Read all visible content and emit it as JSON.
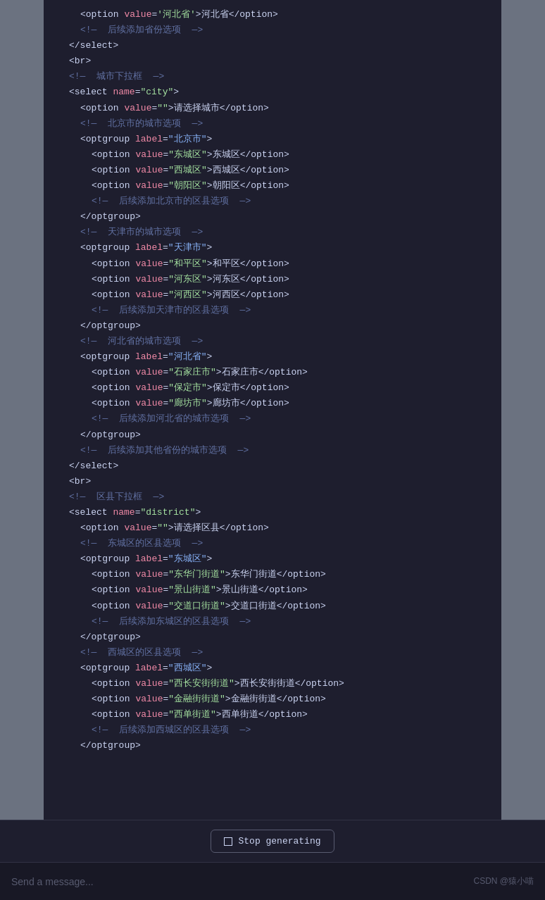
{
  "watermark": "CSDN @猿小喵",
  "input_placeholder": "Send a message...",
  "stop_button_label": "Stop generating",
  "code": {
    "lines": [
      {
        "indent": 2,
        "parts": [
          {
            "type": "tag",
            "text": "<option "
          },
          {
            "type": "attr-name",
            "text": "value"
          },
          {
            "type": "tag",
            "text": "="
          },
          {
            "type": "attr-value",
            "text": "'河北省'"
          },
          {
            "type": "tag",
            "text": ">河北省</option>"
          }
        ]
      },
      {
        "indent": 2,
        "parts": [
          {
            "type": "comment",
            "text": "<!—  后续添加省份选项  —>"
          }
        ]
      },
      {
        "indent": 1,
        "parts": [
          {
            "type": "tag",
            "text": "</select>"
          }
        ]
      },
      {
        "indent": 1,
        "parts": [
          {
            "type": "tag",
            "text": "<br>"
          }
        ]
      },
      {
        "indent": 1,
        "parts": [
          {
            "type": "comment",
            "text": "<!—  城市下拉框  —>"
          }
        ]
      },
      {
        "indent": 1,
        "parts": [
          {
            "type": "tag",
            "text": "<select "
          },
          {
            "type": "attr-name",
            "text": "name"
          },
          {
            "type": "tag",
            "text": "="
          },
          {
            "type": "attr-value",
            "text": "\"city\""
          },
          {
            "type": "tag",
            "text": ">"
          }
        ]
      },
      {
        "indent": 2,
        "parts": [
          {
            "type": "tag",
            "text": "<option "
          },
          {
            "type": "attr-name",
            "text": "value"
          },
          {
            "type": "tag",
            "text": "="
          },
          {
            "type": "attr-value",
            "text": "\"\""
          },
          {
            "type": "tag",
            "text": ">请选择城市</option>"
          }
        ]
      },
      {
        "indent": 2,
        "parts": [
          {
            "type": "comment",
            "text": "<!—  北京市的城市选项  —>"
          }
        ]
      },
      {
        "indent": 2,
        "parts": [
          {
            "type": "tag",
            "text": "<optgroup "
          },
          {
            "type": "attr-name",
            "text": "label"
          },
          {
            "type": "tag",
            "text": "="
          },
          {
            "type": "label-value",
            "text": "\"北京市\""
          },
          {
            "type": "tag",
            "text": ">"
          }
        ]
      },
      {
        "indent": 3,
        "parts": [
          {
            "type": "tag",
            "text": "<option "
          },
          {
            "type": "attr-name",
            "text": "value"
          },
          {
            "type": "tag",
            "text": "="
          },
          {
            "type": "attr-value",
            "text": "\"东城区\""
          },
          {
            "type": "tag",
            "text": ">东城区</option>"
          }
        ]
      },
      {
        "indent": 3,
        "parts": [
          {
            "type": "tag",
            "text": "<option "
          },
          {
            "type": "attr-name",
            "text": "value"
          },
          {
            "type": "tag",
            "text": "="
          },
          {
            "type": "attr-value",
            "text": "\"西城区\""
          },
          {
            "type": "tag",
            "text": ">西城区</option>"
          }
        ]
      },
      {
        "indent": 3,
        "parts": [
          {
            "type": "tag",
            "text": "<option "
          },
          {
            "type": "attr-name",
            "text": "value"
          },
          {
            "type": "tag",
            "text": "="
          },
          {
            "type": "attr-value",
            "text": "\"朝阳区\""
          },
          {
            "type": "tag",
            "text": ">朝阳区</option>"
          }
        ]
      },
      {
        "indent": 3,
        "parts": [
          {
            "type": "comment",
            "text": "<!—  后续添加北京市的区县选项  —>"
          }
        ]
      },
      {
        "indent": 2,
        "parts": [
          {
            "type": "tag",
            "text": "</optgroup>"
          }
        ]
      },
      {
        "indent": 2,
        "parts": [
          {
            "type": "comment",
            "text": "<!—  天津市的城市选项  —>"
          }
        ]
      },
      {
        "indent": 2,
        "parts": [
          {
            "type": "tag",
            "text": "<optgroup "
          },
          {
            "type": "attr-name",
            "text": "label"
          },
          {
            "type": "tag",
            "text": "="
          },
          {
            "type": "label-value",
            "text": "\"天津市\""
          },
          {
            "type": "tag",
            "text": ">"
          }
        ]
      },
      {
        "indent": 3,
        "parts": [
          {
            "type": "tag",
            "text": "<option "
          },
          {
            "type": "attr-name",
            "text": "value"
          },
          {
            "type": "tag",
            "text": "="
          },
          {
            "type": "attr-value",
            "text": "\"和平区\""
          },
          {
            "type": "tag",
            "text": ">和平区</option>"
          }
        ]
      },
      {
        "indent": 3,
        "parts": [
          {
            "type": "tag",
            "text": "<option "
          },
          {
            "type": "attr-name",
            "text": "value"
          },
          {
            "type": "tag",
            "text": "="
          },
          {
            "type": "attr-value",
            "text": "\"河东区\""
          },
          {
            "type": "tag",
            "text": ">河东区</option>"
          }
        ]
      },
      {
        "indent": 3,
        "parts": [
          {
            "type": "tag",
            "text": "<option "
          },
          {
            "type": "attr-name",
            "text": "value"
          },
          {
            "type": "tag",
            "text": "="
          },
          {
            "type": "attr-value",
            "text": "\"河西区\""
          },
          {
            "type": "tag",
            "text": ">河西区</option>"
          }
        ]
      },
      {
        "indent": 3,
        "parts": [
          {
            "type": "comment",
            "text": "<!—  后续添加天津市的区县选项  —>"
          }
        ]
      },
      {
        "indent": 2,
        "parts": [
          {
            "type": "tag",
            "text": "</optgroup>"
          }
        ]
      },
      {
        "indent": 2,
        "parts": [
          {
            "type": "comment",
            "text": "<!—  河北省的城市选项  —>"
          }
        ]
      },
      {
        "indent": 2,
        "parts": [
          {
            "type": "tag",
            "text": "<optgroup "
          },
          {
            "type": "attr-name",
            "text": "label"
          },
          {
            "type": "tag",
            "text": "="
          },
          {
            "type": "label-value",
            "text": "\"河北省\""
          },
          {
            "type": "tag",
            "text": ">"
          }
        ]
      },
      {
        "indent": 3,
        "parts": [
          {
            "type": "tag",
            "text": "<option "
          },
          {
            "type": "attr-name",
            "text": "value"
          },
          {
            "type": "tag",
            "text": "="
          },
          {
            "type": "attr-value",
            "text": "\"石家庄市\""
          },
          {
            "type": "tag",
            "text": ">石家庄市</option>"
          }
        ]
      },
      {
        "indent": 3,
        "parts": [
          {
            "type": "tag",
            "text": "<option "
          },
          {
            "type": "attr-name",
            "text": "value"
          },
          {
            "type": "tag",
            "text": "="
          },
          {
            "type": "attr-value",
            "text": "\"保定市\""
          },
          {
            "type": "tag",
            "text": ">保定市</option>"
          }
        ]
      },
      {
        "indent": 3,
        "parts": [
          {
            "type": "tag",
            "text": "<option "
          },
          {
            "type": "attr-name",
            "text": "value"
          },
          {
            "type": "tag",
            "text": "="
          },
          {
            "type": "attr-value",
            "text": "\"廊坊市\""
          },
          {
            "type": "tag",
            "text": ">廊坊市</option>"
          }
        ]
      },
      {
        "indent": 3,
        "parts": [
          {
            "type": "comment",
            "text": "<!—  后续添加河北省的城市选项  —>"
          }
        ]
      },
      {
        "indent": 2,
        "parts": [
          {
            "type": "tag",
            "text": "</optgroup>"
          }
        ]
      },
      {
        "indent": 2,
        "parts": [
          {
            "type": "comment",
            "text": "<!—  后续添加其他省份的城市选项  —>"
          }
        ]
      },
      {
        "indent": 1,
        "parts": [
          {
            "type": "tag",
            "text": "</select>"
          }
        ]
      },
      {
        "indent": 1,
        "parts": [
          {
            "type": "tag",
            "text": "<br>"
          }
        ]
      },
      {
        "indent": 1,
        "parts": [
          {
            "type": "comment",
            "text": "<!—  区县下拉框  —>"
          }
        ]
      },
      {
        "indent": 1,
        "parts": [
          {
            "type": "tag",
            "text": "<select "
          },
          {
            "type": "attr-name",
            "text": "name"
          },
          {
            "type": "tag",
            "text": "="
          },
          {
            "type": "attr-value",
            "text": "\"district\""
          },
          {
            "type": "tag",
            "text": ">"
          }
        ]
      },
      {
        "indent": 2,
        "parts": [
          {
            "type": "tag",
            "text": "<option "
          },
          {
            "type": "attr-name",
            "text": "value"
          },
          {
            "type": "tag",
            "text": "="
          },
          {
            "type": "attr-value",
            "text": "\"\""
          },
          {
            "type": "tag",
            "text": ">请选择区县</option>"
          }
        ]
      },
      {
        "indent": 2,
        "parts": [
          {
            "type": "comment",
            "text": "<!—  东城区的区县选项  —>"
          }
        ]
      },
      {
        "indent": 2,
        "parts": [
          {
            "type": "tag",
            "text": "<optgroup "
          },
          {
            "type": "attr-name",
            "text": "label"
          },
          {
            "type": "tag",
            "text": "="
          },
          {
            "type": "label-value",
            "text": "\"东城区\""
          },
          {
            "type": "tag",
            "text": ">"
          }
        ]
      },
      {
        "indent": 3,
        "parts": [
          {
            "type": "tag",
            "text": "<option "
          },
          {
            "type": "attr-name",
            "text": "value"
          },
          {
            "type": "tag",
            "text": "="
          },
          {
            "type": "attr-value",
            "text": "\"东华门街道\""
          },
          {
            "type": "tag",
            "text": ">东华门街道</option>"
          }
        ]
      },
      {
        "indent": 3,
        "parts": [
          {
            "type": "tag",
            "text": "<option "
          },
          {
            "type": "attr-name",
            "text": "value"
          },
          {
            "type": "tag",
            "text": "="
          },
          {
            "type": "attr-value",
            "text": "\"景山街道\""
          },
          {
            "type": "tag",
            "text": ">景山街道</option>"
          }
        ]
      },
      {
        "indent": 3,
        "parts": [
          {
            "type": "tag",
            "text": "<option "
          },
          {
            "type": "attr-name",
            "text": "value"
          },
          {
            "type": "tag",
            "text": "="
          },
          {
            "type": "attr-value",
            "text": "\"交道口街道\""
          },
          {
            "type": "tag",
            "text": ">交道口街道</option>"
          }
        ]
      },
      {
        "indent": 3,
        "parts": [
          {
            "type": "comment",
            "text": "<!—  后续添加东城区的区县选项  —>"
          }
        ]
      },
      {
        "indent": 2,
        "parts": [
          {
            "type": "tag",
            "text": "</optgroup>"
          }
        ]
      },
      {
        "indent": 2,
        "parts": [
          {
            "type": "comment",
            "text": "<!—  西城区的区县选项  —>"
          }
        ]
      },
      {
        "indent": 2,
        "parts": [
          {
            "type": "tag",
            "text": "<optgroup "
          },
          {
            "type": "attr-name",
            "text": "label"
          },
          {
            "type": "tag",
            "text": "="
          },
          {
            "type": "label-value",
            "text": "\"西城区\""
          },
          {
            "type": "tag",
            "text": ">"
          }
        ]
      },
      {
        "indent": 3,
        "parts": [
          {
            "type": "tag",
            "text": "<option "
          },
          {
            "type": "attr-name",
            "text": "value"
          },
          {
            "type": "tag",
            "text": "="
          },
          {
            "type": "attr-value",
            "text": "\"西长安街街道\""
          },
          {
            "type": "tag",
            "text": ">西长安街街道</option>"
          }
        ]
      },
      {
        "indent": 3,
        "parts": [
          {
            "type": "tag",
            "text": "<option "
          },
          {
            "type": "attr-name",
            "text": "value"
          },
          {
            "type": "tag",
            "text": "="
          },
          {
            "type": "attr-value",
            "text": "\"金融街街道\""
          },
          {
            "type": "tag",
            "text": ">金融街街道</option>"
          }
        ]
      },
      {
        "indent": 3,
        "parts": [
          {
            "type": "tag",
            "text": "<option "
          },
          {
            "type": "attr-name",
            "text": "value"
          },
          {
            "type": "tag",
            "text": "="
          },
          {
            "type": "attr-value",
            "text": "\"西单街道\""
          },
          {
            "type": "tag",
            "text": ">西单街道</option>"
          }
        ]
      },
      {
        "indent": 3,
        "parts": [
          {
            "type": "comment",
            "text": "<!—  后续添加西城区的区县选项  —>"
          }
        ]
      },
      {
        "indent": 2,
        "parts": [
          {
            "type": "tag",
            "text": "</optgroup>"
          }
        ]
      }
    ]
  }
}
